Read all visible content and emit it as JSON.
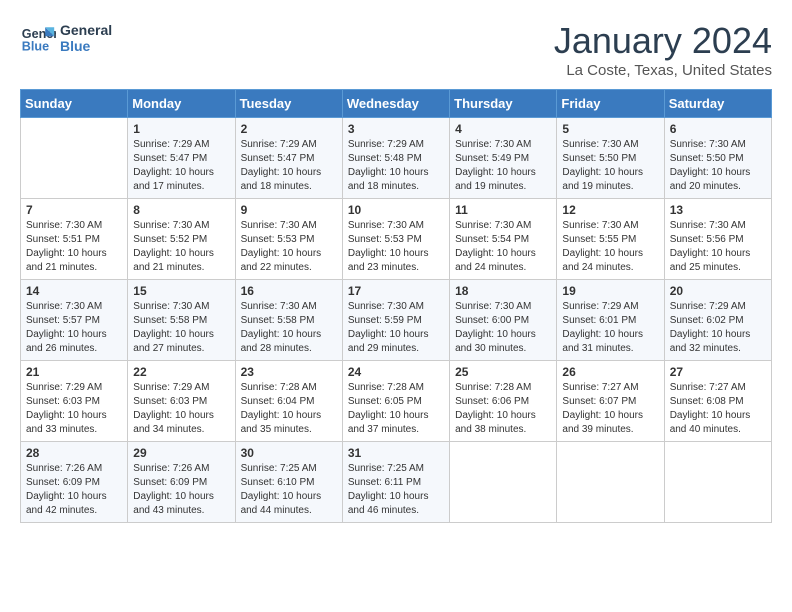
{
  "header": {
    "logo_line1": "General",
    "logo_line2": "Blue",
    "title": "January 2024",
    "subtitle": "La Coste, Texas, United States"
  },
  "columns": [
    "Sunday",
    "Monday",
    "Tuesday",
    "Wednesday",
    "Thursday",
    "Friday",
    "Saturday"
  ],
  "weeks": [
    [
      {
        "day": "",
        "sunrise": "",
        "sunset": "",
        "daylight": ""
      },
      {
        "day": "1",
        "sunrise": "Sunrise: 7:29 AM",
        "sunset": "Sunset: 5:47 PM",
        "daylight": "Daylight: 10 hours and 17 minutes."
      },
      {
        "day": "2",
        "sunrise": "Sunrise: 7:29 AM",
        "sunset": "Sunset: 5:47 PM",
        "daylight": "Daylight: 10 hours and 18 minutes."
      },
      {
        "day": "3",
        "sunrise": "Sunrise: 7:29 AM",
        "sunset": "Sunset: 5:48 PM",
        "daylight": "Daylight: 10 hours and 18 minutes."
      },
      {
        "day": "4",
        "sunrise": "Sunrise: 7:30 AM",
        "sunset": "Sunset: 5:49 PM",
        "daylight": "Daylight: 10 hours and 19 minutes."
      },
      {
        "day": "5",
        "sunrise": "Sunrise: 7:30 AM",
        "sunset": "Sunset: 5:50 PM",
        "daylight": "Daylight: 10 hours and 19 minutes."
      },
      {
        "day": "6",
        "sunrise": "Sunrise: 7:30 AM",
        "sunset": "Sunset: 5:50 PM",
        "daylight": "Daylight: 10 hours and 20 minutes."
      }
    ],
    [
      {
        "day": "7",
        "sunrise": "Sunrise: 7:30 AM",
        "sunset": "Sunset: 5:51 PM",
        "daylight": "Daylight: 10 hours and 21 minutes."
      },
      {
        "day": "8",
        "sunrise": "Sunrise: 7:30 AM",
        "sunset": "Sunset: 5:52 PM",
        "daylight": "Daylight: 10 hours and 21 minutes."
      },
      {
        "day": "9",
        "sunrise": "Sunrise: 7:30 AM",
        "sunset": "Sunset: 5:53 PM",
        "daylight": "Daylight: 10 hours and 22 minutes."
      },
      {
        "day": "10",
        "sunrise": "Sunrise: 7:30 AM",
        "sunset": "Sunset: 5:53 PM",
        "daylight": "Daylight: 10 hours and 23 minutes."
      },
      {
        "day": "11",
        "sunrise": "Sunrise: 7:30 AM",
        "sunset": "Sunset: 5:54 PM",
        "daylight": "Daylight: 10 hours and 24 minutes."
      },
      {
        "day": "12",
        "sunrise": "Sunrise: 7:30 AM",
        "sunset": "Sunset: 5:55 PM",
        "daylight": "Daylight: 10 hours and 24 minutes."
      },
      {
        "day": "13",
        "sunrise": "Sunrise: 7:30 AM",
        "sunset": "Sunset: 5:56 PM",
        "daylight": "Daylight: 10 hours and 25 minutes."
      }
    ],
    [
      {
        "day": "14",
        "sunrise": "Sunrise: 7:30 AM",
        "sunset": "Sunset: 5:57 PM",
        "daylight": "Daylight: 10 hours and 26 minutes."
      },
      {
        "day": "15",
        "sunrise": "Sunrise: 7:30 AM",
        "sunset": "Sunset: 5:58 PM",
        "daylight": "Daylight: 10 hours and 27 minutes."
      },
      {
        "day": "16",
        "sunrise": "Sunrise: 7:30 AM",
        "sunset": "Sunset: 5:58 PM",
        "daylight": "Daylight: 10 hours and 28 minutes."
      },
      {
        "day": "17",
        "sunrise": "Sunrise: 7:30 AM",
        "sunset": "Sunset: 5:59 PM",
        "daylight": "Daylight: 10 hours and 29 minutes."
      },
      {
        "day": "18",
        "sunrise": "Sunrise: 7:30 AM",
        "sunset": "Sunset: 6:00 PM",
        "daylight": "Daylight: 10 hours and 30 minutes."
      },
      {
        "day": "19",
        "sunrise": "Sunrise: 7:29 AM",
        "sunset": "Sunset: 6:01 PM",
        "daylight": "Daylight: 10 hours and 31 minutes."
      },
      {
        "day": "20",
        "sunrise": "Sunrise: 7:29 AM",
        "sunset": "Sunset: 6:02 PM",
        "daylight": "Daylight: 10 hours and 32 minutes."
      }
    ],
    [
      {
        "day": "21",
        "sunrise": "Sunrise: 7:29 AM",
        "sunset": "Sunset: 6:03 PM",
        "daylight": "Daylight: 10 hours and 33 minutes."
      },
      {
        "day": "22",
        "sunrise": "Sunrise: 7:29 AM",
        "sunset": "Sunset: 6:03 PM",
        "daylight": "Daylight: 10 hours and 34 minutes."
      },
      {
        "day": "23",
        "sunrise": "Sunrise: 7:28 AM",
        "sunset": "Sunset: 6:04 PM",
        "daylight": "Daylight: 10 hours and 35 minutes."
      },
      {
        "day": "24",
        "sunrise": "Sunrise: 7:28 AM",
        "sunset": "Sunset: 6:05 PM",
        "daylight": "Daylight: 10 hours and 37 minutes."
      },
      {
        "day": "25",
        "sunrise": "Sunrise: 7:28 AM",
        "sunset": "Sunset: 6:06 PM",
        "daylight": "Daylight: 10 hours and 38 minutes."
      },
      {
        "day": "26",
        "sunrise": "Sunrise: 7:27 AM",
        "sunset": "Sunset: 6:07 PM",
        "daylight": "Daylight: 10 hours and 39 minutes."
      },
      {
        "day": "27",
        "sunrise": "Sunrise: 7:27 AM",
        "sunset": "Sunset: 6:08 PM",
        "daylight": "Daylight: 10 hours and 40 minutes."
      }
    ],
    [
      {
        "day": "28",
        "sunrise": "Sunrise: 7:26 AM",
        "sunset": "Sunset: 6:09 PM",
        "daylight": "Daylight: 10 hours and 42 minutes."
      },
      {
        "day": "29",
        "sunrise": "Sunrise: 7:26 AM",
        "sunset": "Sunset: 6:09 PM",
        "daylight": "Daylight: 10 hours and 43 minutes."
      },
      {
        "day": "30",
        "sunrise": "Sunrise: 7:25 AM",
        "sunset": "Sunset: 6:10 PM",
        "daylight": "Daylight: 10 hours and 44 minutes."
      },
      {
        "day": "31",
        "sunrise": "Sunrise: 7:25 AM",
        "sunset": "Sunset: 6:11 PM",
        "daylight": "Daylight: 10 hours and 46 minutes."
      },
      {
        "day": "",
        "sunrise": "",
        "sunset": "",
        "daylight": ""
      },
      {
        "day": "",
        "sunrise": "",
        "sunset": "",
        "daylight": ""
      },
      {
        "day": "",
        "sunrise": "",
        "sunset": "",
        "daylight": ""
      }
    ]
  ]
}
